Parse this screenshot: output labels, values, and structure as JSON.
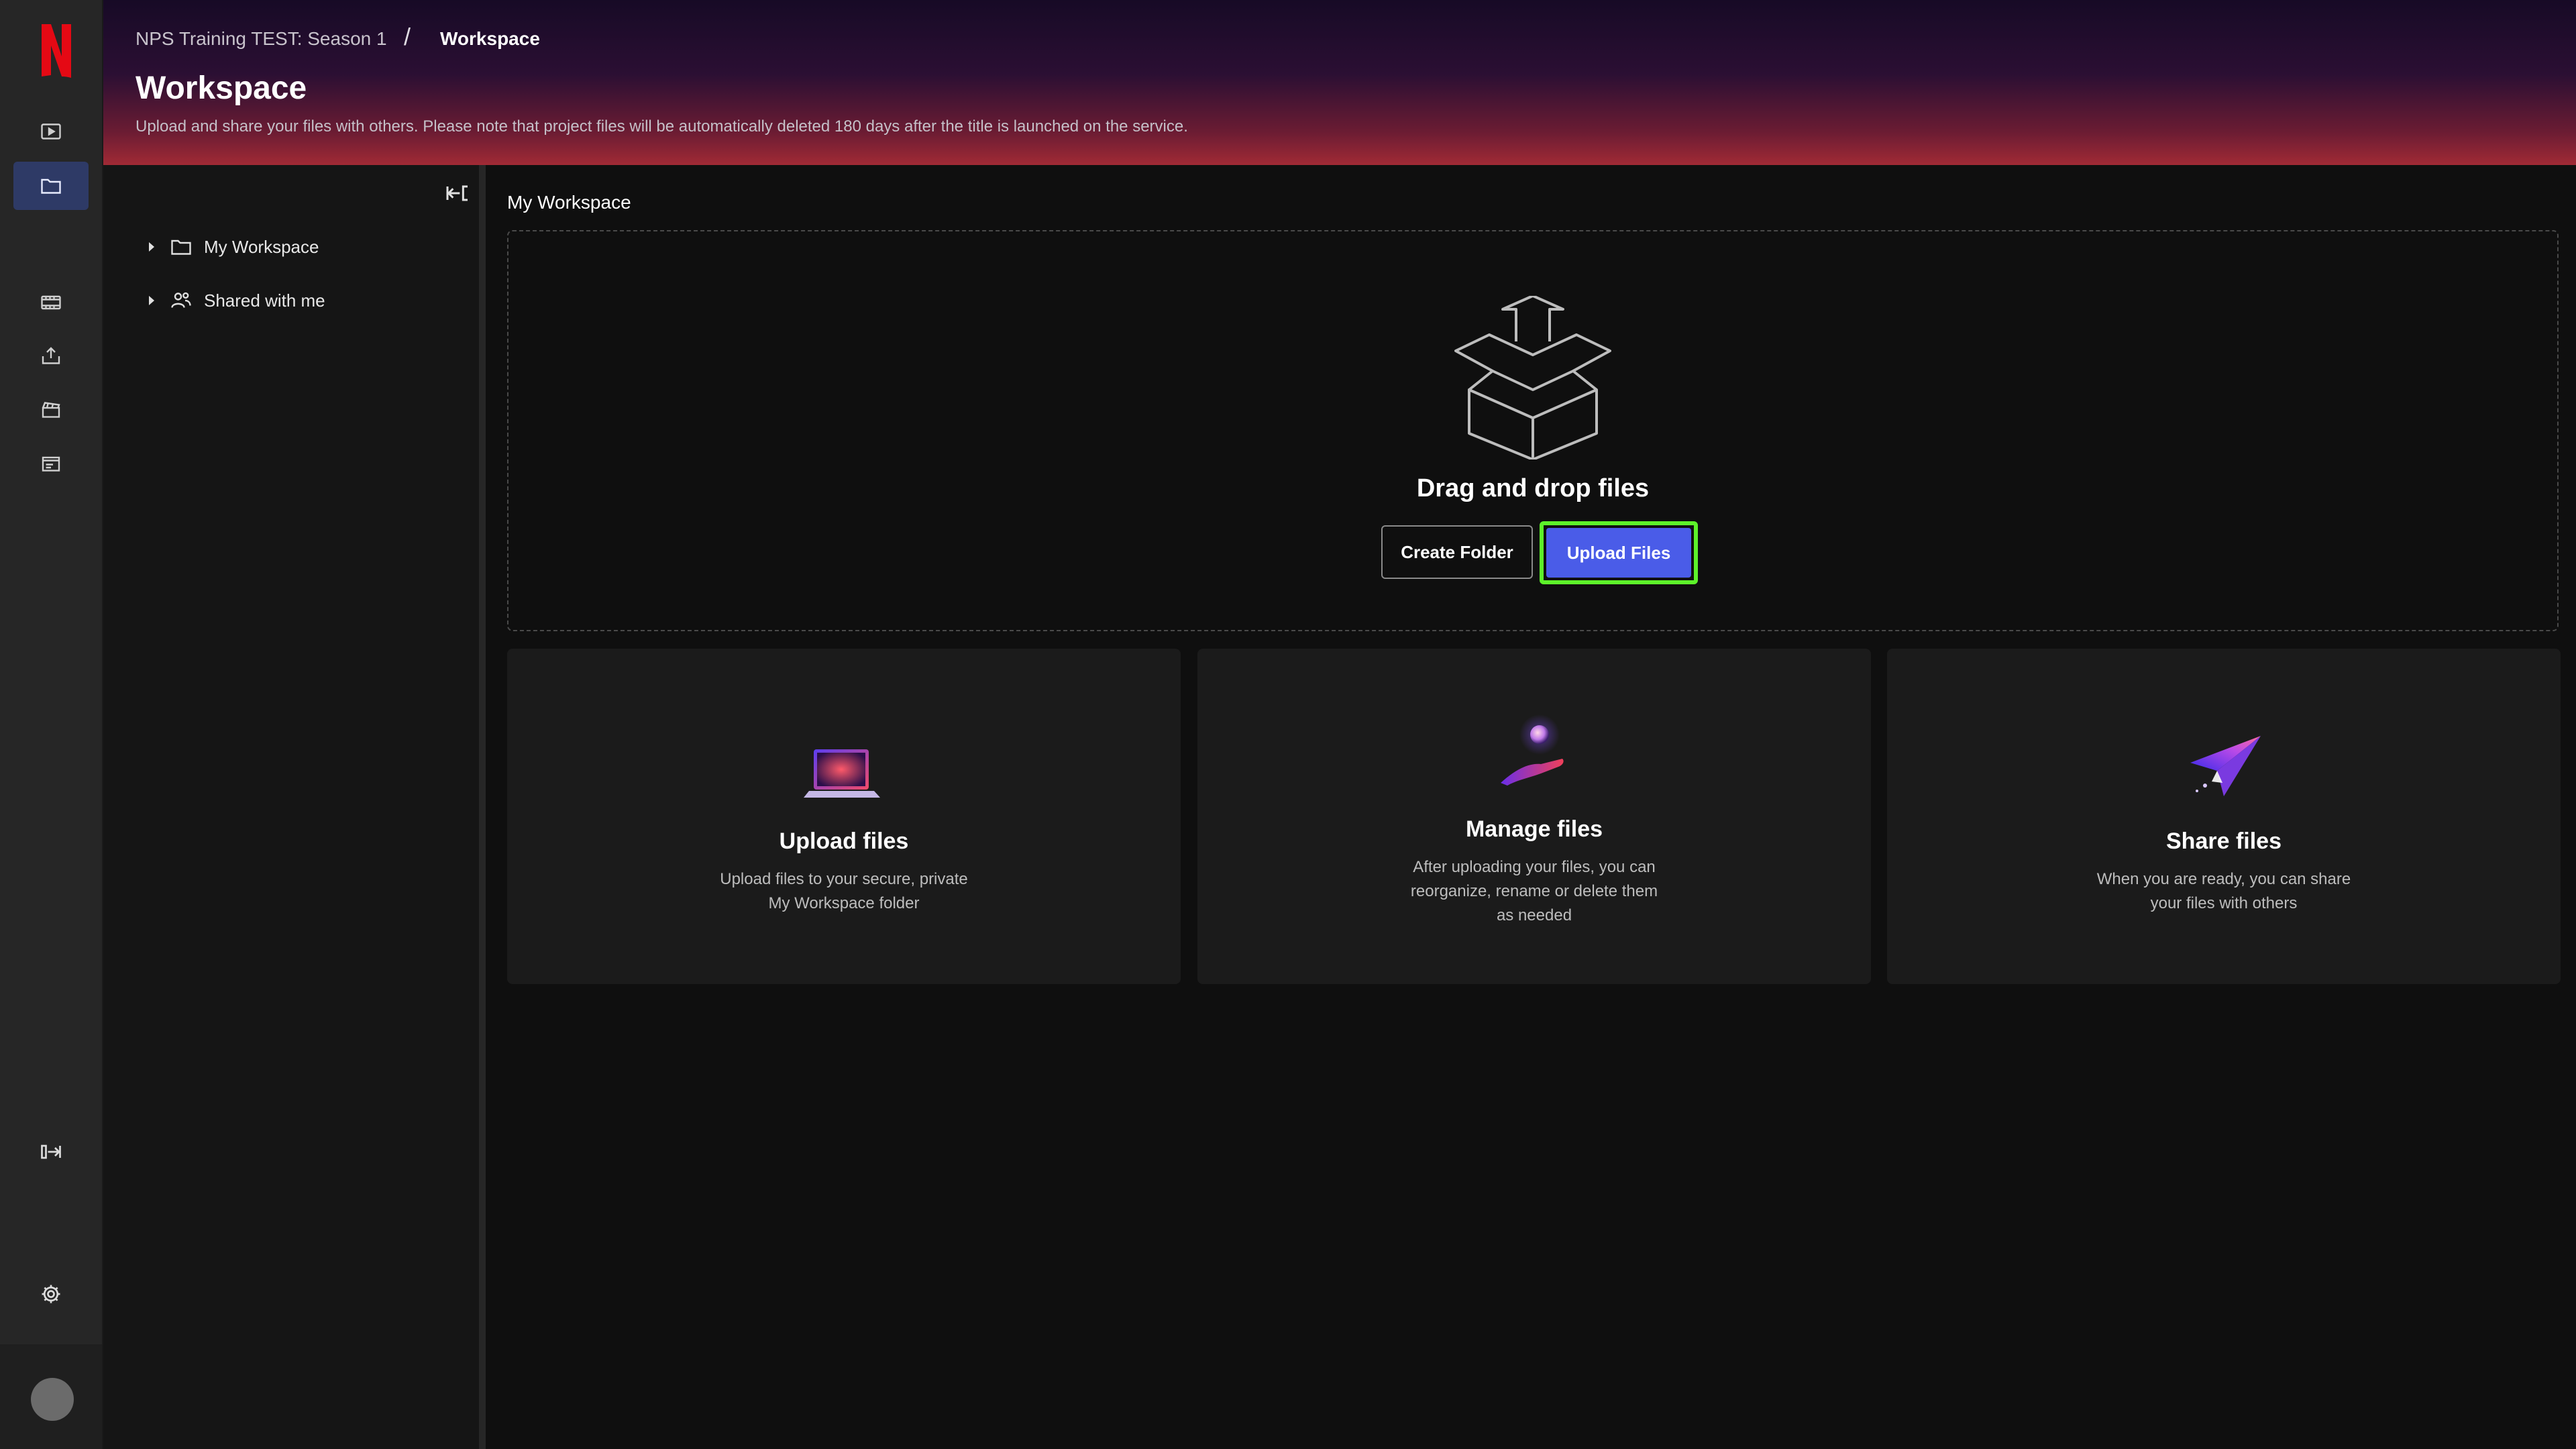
{
  "breadcrumb": {
    "parent": "NPS Training TEST: Season 1",
    "separator": "/",
    "current": "Workspace"
  },
  "header": {
    "title": "Workspace",
    "description": "Upload and share your files with others. Please note that project files will be automatically deleted 180 days after the title is launched on the service."
  },
  "sidebar": {
    "logo_letter": "N",
    "nav_icons": [
      "play-icon",
      "folder-icon",
      "film-strip-icon",
      "upload-tray-icon",
      "clapperboard-icon",
      "schedule-list-icon",
      "expand-icon",
      "gear-icon"
    ]
  },
  "tree": {
    "items": [
      {
        "label": "My Workspace",
        "icon": "folder-icon"
      },
      {
        "label": "Shared with me",
        "icon": "shared-users-icon"
      }
    ]
  },
  "main": {
    "section_title": "My Workspace",
    "dropzone": {
      "title": "Drag and drop files",
      "create_folder": "Create Folder",
      "upload_files": "Upload Files"
    },
    "cards": [
      {
        "title": "Upload files",
        "desc_lines": [
          "Upload files to your secure, private",
          "My Workspace folder"
        ]
      },
      {
        "title": "Manage files",
        "desc_lines": [
          "After uploading your files, you can",
          "reorganize, rename or delete them",
          "as needed"
        ]
      },
      {
        "title": "Share files",
        "desc_lines": [
          "When you are ready, you can share",
          "your files with others"
        ]
      }
    ]
  },
  "colors": {
    "accent": "#4a5ce8",
    "highlight": "#5df22a",
    "brand": "#e50914"
  }
}
